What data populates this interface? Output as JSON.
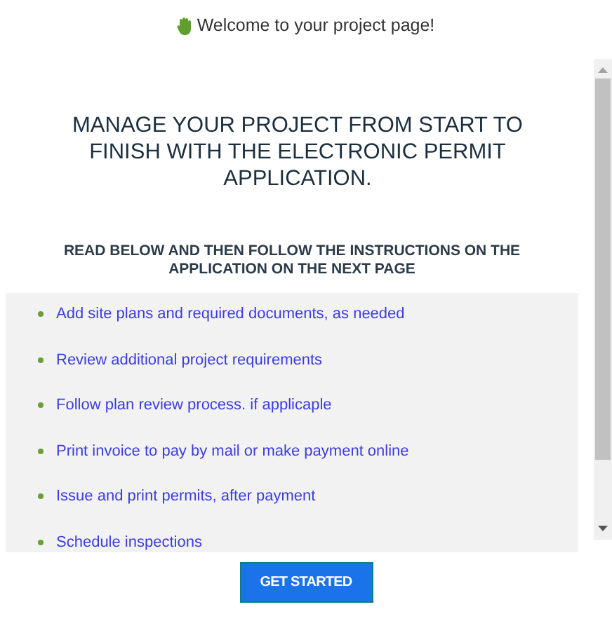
{
  "title": "Welcome to your project page!",
  "headline": "MANAGE YOUR PROJECT FROM START TO FINISH WITH THE ELECTRONIC PERMIT APPLICATION.",
  "instructions": "READ BELOW AND THEN FOLLOW THE INSTRUCTIONS ON THE APPLICATION ON THE NEXT PAGE",
  "steps": [
    "Add site plans and required documents, as needed",
    "Review additional project requirements",
    "Follow plan review process. if applicaple",
    "Print invoice to pay by mail or make payment online",
    "Issue and print permits, after payment",
    "Schedule inspections"
  ],
  "button": "GET STARTED"
}
